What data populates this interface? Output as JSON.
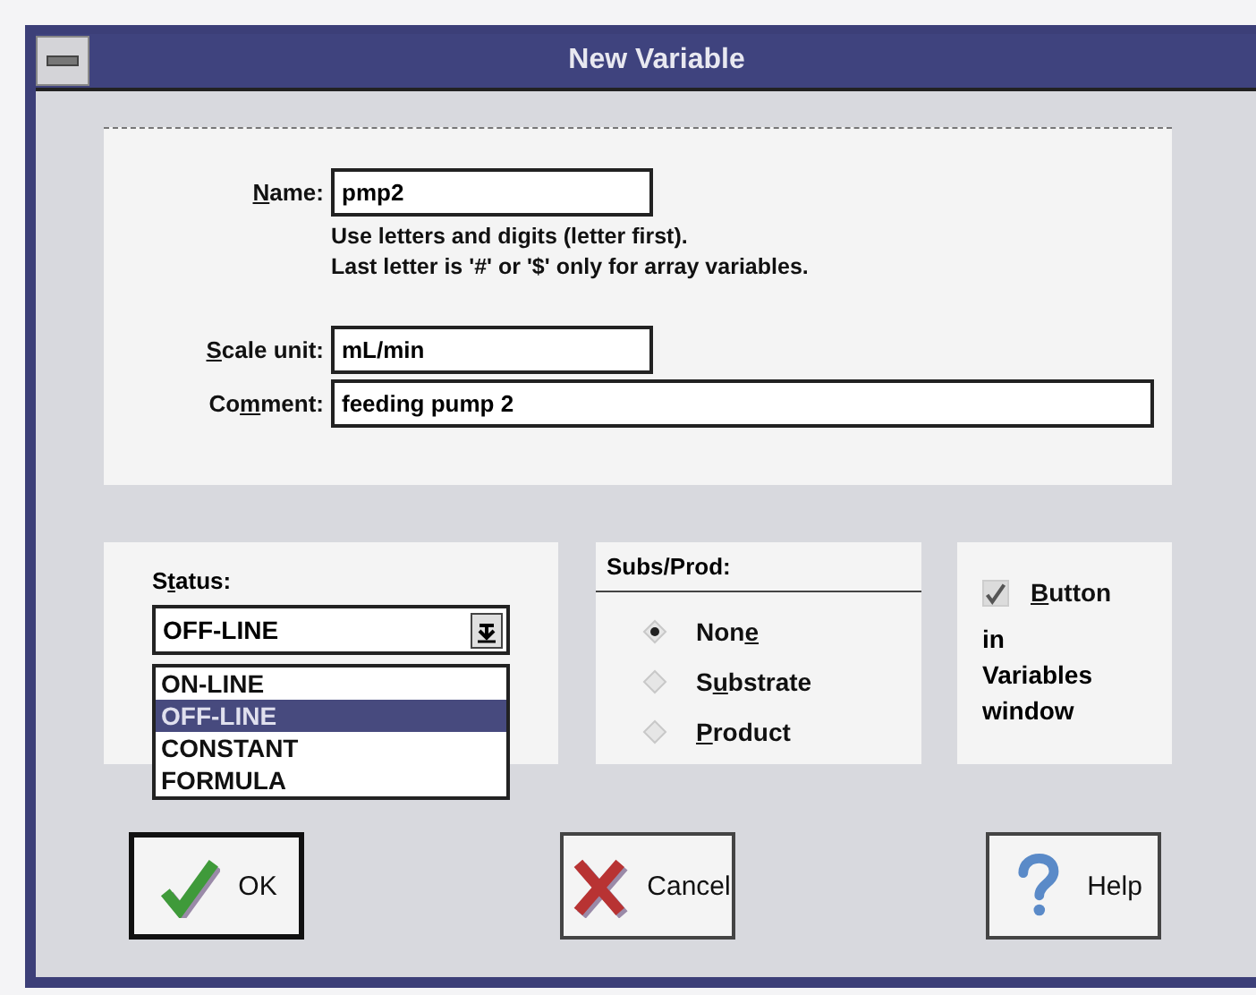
{
  "window": {
    "title": "New Variable"
  },
  "fields": [
    {
      "label": {
        "key": "N",
        "post": "ame:"
      },
      "value": "pmp2",
      "kind": "short",
      "hint": [
        "Use letters and digits (letter first).",
        "Last letter is '#' or '$' only for array variables."
      ]
    },
    {
      "label": {
        "key": "S",
        "post": "cale unit:"
      },
      "value": "mL/min",
      "kind": "short"
    },
    {
      "label": {
        "pre": "Co",
        "key": "m",
        "post": "ment:"
      },
      "value": "feeding pump 2",
      "kind": "long"
    }
  ],
  "status": {
    "label": {
      "pre": "S",
      "key": "t",
      "post": "atus:"
    },
    "value": "OFF-LINE",
    "expanded": true,
    "options": [
      {
        "label": "ON-LINE",
        "selected": false
      },
      {
        "label": "OFF-LINE",
        "selected": true
      },
      {
        "label": "CONSTANT",
        "selected": false
      },
      {
        "label": "FORMULA",
        "selected": false
      }
    ]
  },
  "subs_prod": {
    "title": "Subs/Prod:",
    "options": [
      {
        "label": {
          "pre": "Non",
          "key": "e"
        },
        "selected": true
      },
      {
        "label": {
          "pre": "S",
          "key": "u",
          "post": "bstrate"
        },
        "selected": false
      },
      {
        "label": {
          "key": "P",
          "post": "roduct"
        },
        "selected": false
      }
    ]
  },
  "button_option": {
    "label": {
      "key": "B",
      "post": "utton"
    },
    "checked": true,
    "note": "in Variables window"
  },
  "buttons": [
    {
      "label": "OK",
      "kind": "ok",
      "default": true
    },
    {
      "label": "Cancel",
      "kind": "cancel",
      "default": false
    },
    {
      "label": "Help",
      "kind": "help",
      "default": false
    }
  ]
}
